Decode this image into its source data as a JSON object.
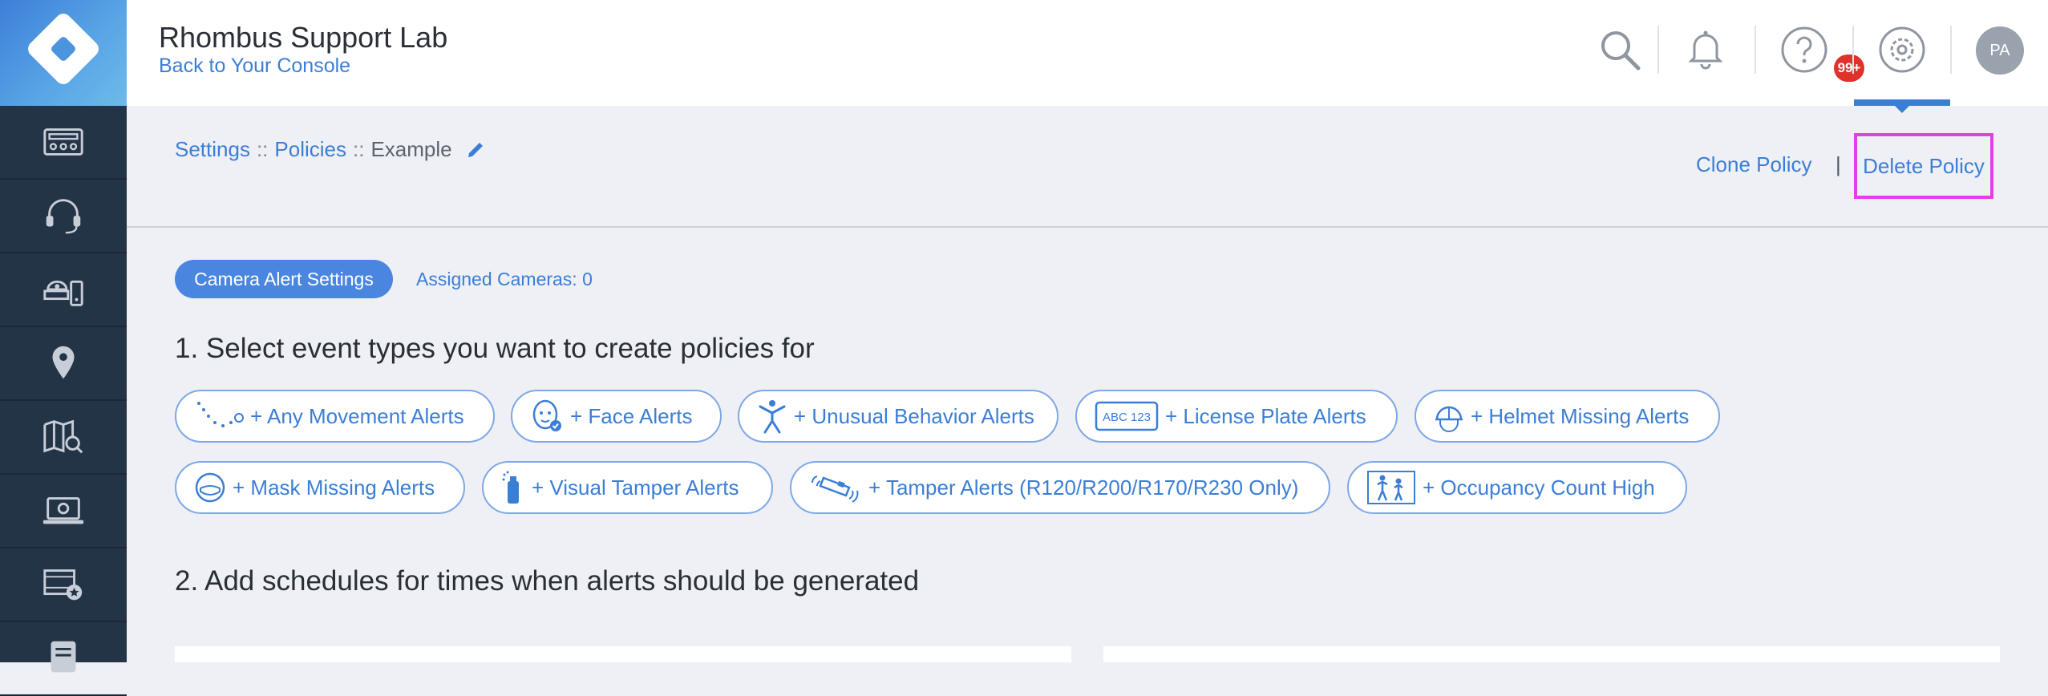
{
  "header": {
    "org_name": "Rhombus Support Lab",
    "back_link": "Back to Your Console",
    "notification_badge": "99+",
    "avatar_initials": "PA"
  },
  "breadcrumb": {
    "settings": "Settings",
    "sep1": "::",
    "policies": "Policies",
    "sep2": "::",
    "current": "Example"
  },
  "actions": {
    "clone": "Clone Policy",
    "separator": "|",
    "delete": "Delete Policy"
  },
  "tabs": {
    "active": "Camera Alert Settings",
    "assigned": "Assigned Cameras: 0"
  },
  "steps": {
    "one": "1. Select event types you want to create policies for",
    "two": "2. Add schedules for times when alerts should be generated"
  },
  "alert_chips": [
    {
      "label": "+ Any Movement Alerts",
      "icon": "movement-icon"
    },
    {
      "label": "+ Face Alerts",
      "icon": "face-icon"
    },
    {
      "label": "+ Unusual Behavior Alerts",
      "icon": "person-icon"
    },
    {
      "label": "+ License Plate Alerts",
      "icon": "license-plate-icon",
      "icon_text": "ABC 123"
    },
    {
      "label": "+ Helmet Missing Alerts",
      "icon": "helmet-icon"
    },
    {
      "label": "+ Mask Missing Alerts",
      "icon": "mask-icon"
    },
    {
      "label": "+ Visual Tamper Alerts",
      "icon": "spray-icon"
    },
    {
      "label": "+ Tamper Alerts (R120/R200/R170/R230 Only)",
      "icon": "camera-tamper-icon"
    },
    {
      "label": "+ Occupancy Count High",
      "icon": "occupancy-icon"
    }
  ],
  "colors": {
    "sidebar": "#243447",
    "accent": "#3b7ed6",
    "highlight": "#e040e6",
    "badge": "#e0312b"
  }
}
